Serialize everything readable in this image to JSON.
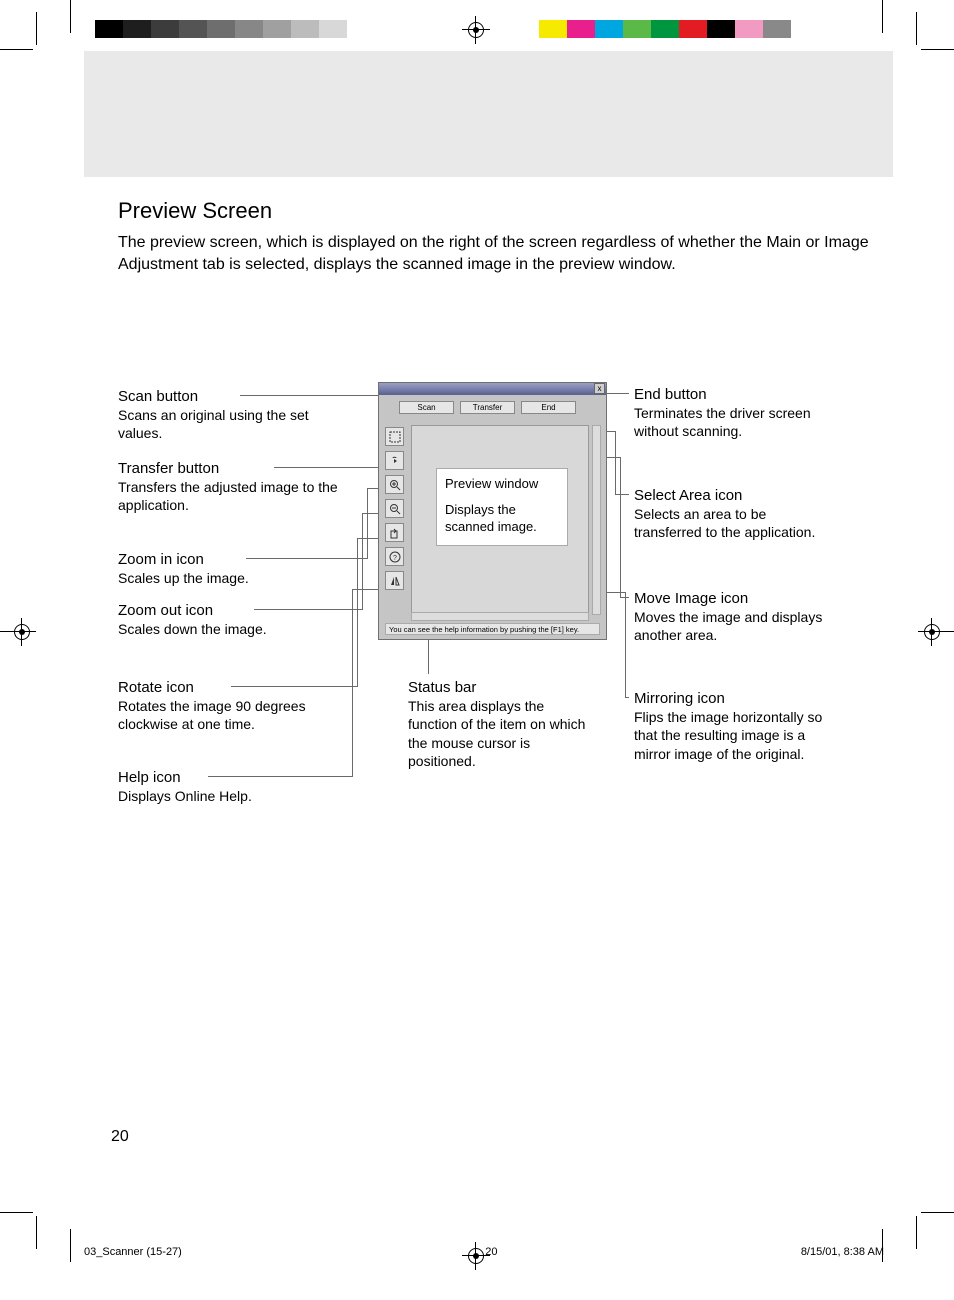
{
  "section_title": "Preview Screen",
  "intro": "The preview screen, which is displayed on the right of the screen regardless of whether the Main or Image Adjustment tab is selected, displays the scanned image in the preview window.",
  "window": {
    "close": "x",
    "buttons": {
      "scan": "Scan",
      "transfer": "Transfer",
      "end": "End"
    },
    "preview_note": {
      "title": "Preview window",
      "desc": "Displays the scanned image."
    },
    "status_hint": "You can see the help information by pushing the [F1] key."
  },
  "callouts": {
    "scan": {
      "title": "Scan button",
      "desc": "Scans an original using the set values."
    },
    "transfer": {
      "title": "Transfer button",
      "desc": "Transfers the adjusted image to the application."
    },
    "zoom_in": {
      "title": "Zoom in icon",
      "desc": "Scales up the image."
    },
    "zoom_out": {
      "title": "Zoom out icon",
      "desc": "Scales down the image."
    },
    "rotate": {
      "title": "Rotate icon",
      "desc": "Rotates the image 90 degrees clockwise at one time."
    },
    "help": {
      "title": "Help icon",
      "desc": "Displays Online Help."
    },
    "status": {
      "title": "Status bar",
      "desc": "This area displays the function of the item on which the mouse cursor is positioned."
    },
    "end": {
      "title": "End button",
      "desc": "Terminates the driver screen without scanning."
    },
    "select_area": {
      "title": "Select Area icon",
      "desc": "Selects an area to be transferred to the application."
    },
    "move_image": {
      "title": "Move Image icon",
      "desc": "Moves the image and displays another area."
    },
    "mirror": {
      "title": "Mirroring icon",
      "desc": "Flips the image horizontally so that the resulting image is a mirror image of the original."
    }
  },
  "page_number": "20",
  "footer": {
    "file": "03_Scanner (15-27)",
    "page": "20",
    "datetime": "8/15/01, 8:38 AM"
  },
  "print_bars": {
    "grayscale": [
      "#000000",
      "#1e1e1e",
      "#3c3c3c",
      "#545454",
      "#6e6e6e",
      "#878787",
      "#a0a0a0",
      "#bcbcbc",
      "#d8d8d8",
      "#ffffff"
    ],
    "color": [
      "#f6ea00",
      "#ea1f8e",
      "#00a6e0",
      "#5bba47",
      "#00963f",
      "#e31b23",
      "#000000",
      "#f29ac1",
      "#898989"
    ]
  }
}
